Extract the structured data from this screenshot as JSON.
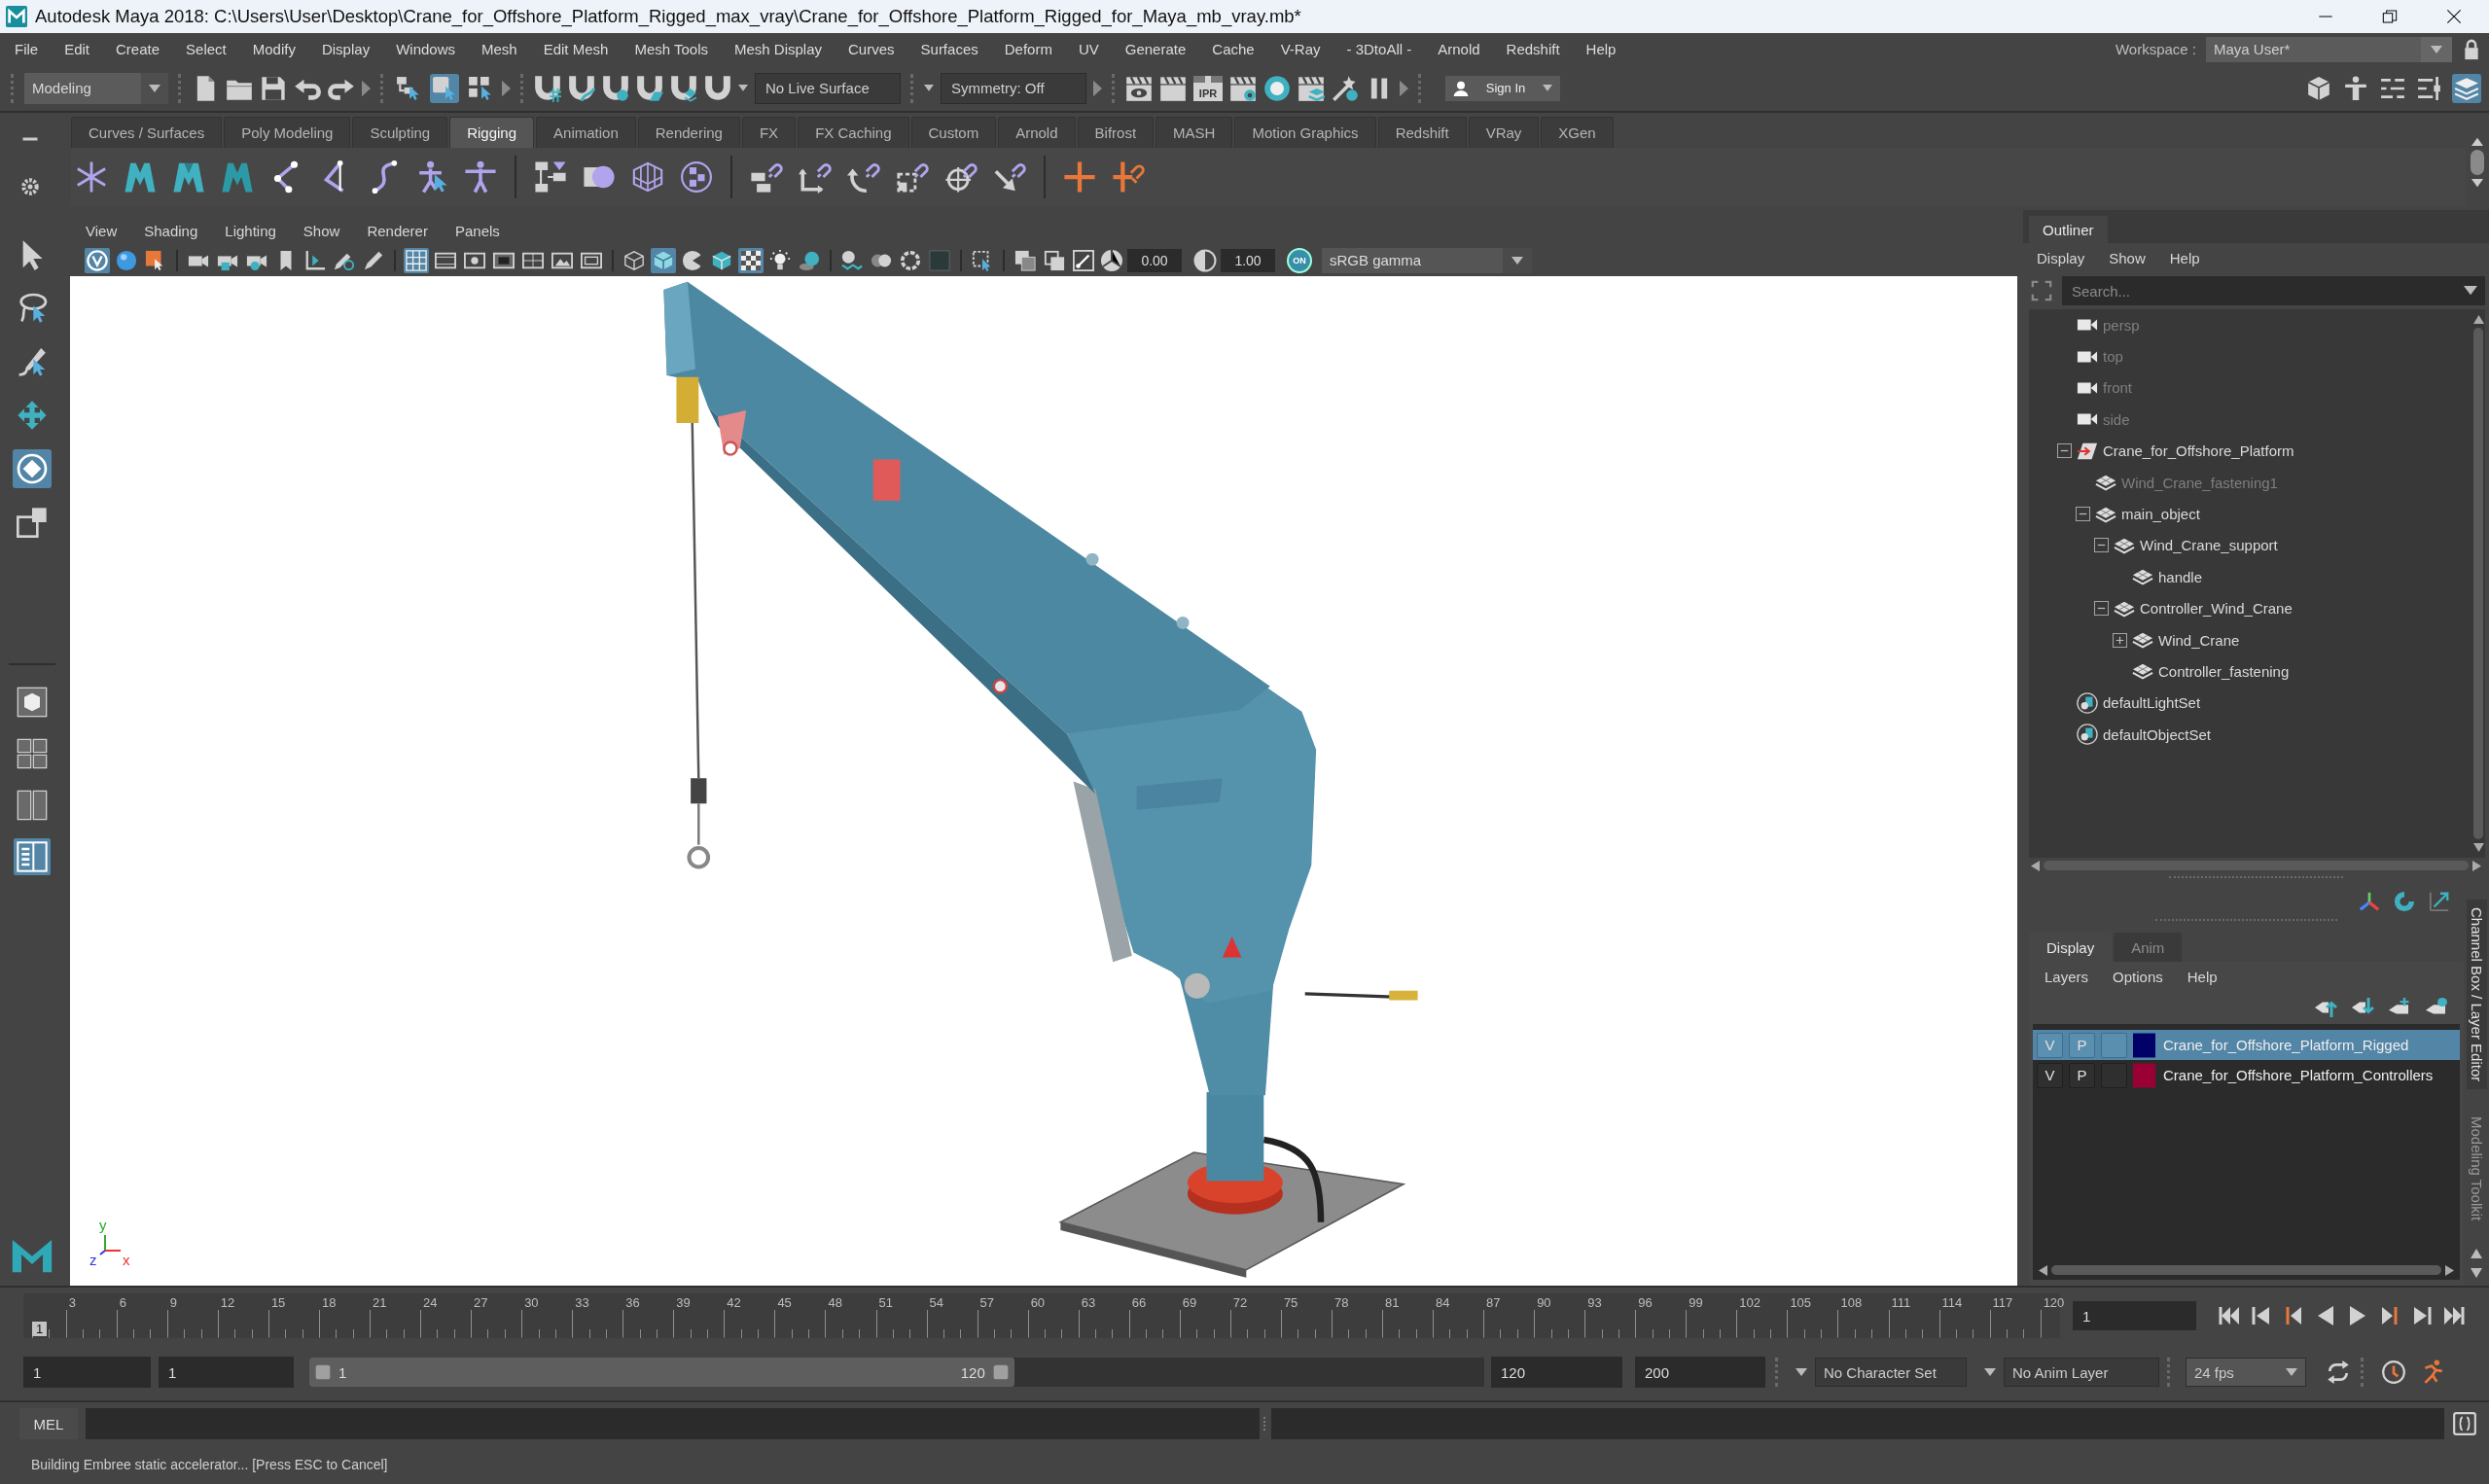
{
  "window": {
    "title": "Autodesk Maya 2018: C:\\Users\\User\\Desktop\\Crane_for_Offshore_Platform_Rigged_max_vray\\Crane_for_Offshore_Platform_Rigged_for_Maya_mb_vray.mb*"
  },
  "menu_bar": {
    "items": [
      "File",
      "Edit",
      "Create",
      "Select",
      "Modify",
      "Display",
      "Windows",
      "Mesh",
      "Edit Mesh",
      "Mesh Tools",
      "Mesh Display",
      "Curves",
      "Surfaces",
      "Deform",
      "UV",
      "Generate",
      "Cache",
      "V-Ray",
      "- 3DtoAll -",
      "Arnold",
      "Redshift",
      "Help"
    ],
    "workspace_label": "Workspace :",
    "workspace": "Maya User*"
  },
  "status_line": {
    "menu_set": "Modeling",
    "selection_modes": [
      {
        "selected": false
      },
      {
        "selected": true
      },
      {
        "selected": false
      }
    ],
    "live_surface": "No Live Surface",
    "symmetry": "Symmetry: Off",
    "ipr_label": "IPR",
    "sign_in": "Sign In",
    "panel_toggles": [
      {
        "on": false
      },
      {
        "on": false
      },
      {
        "on": false
      },
      {
        "on": false
      },
      {
        "on": true
      }
    ]
  },
  "shelf": {
    "tabs": [
      {
        "label": "Curves / Surfaces",
        "selected": false
      },
      {
        "label": "Poly Modeling",
        "selected": false
      },
      {
        "label": "Sculpting",
        "selected": false
      },
      {
        "label": "Rigging",
        "selected": true
      },
      {
        "label": "Animation",
        "selected": false
      },
      {
        "label": "Rendering",
        "selected": false
      },
      {
        "label": "FX",
        "selected": false
      },
      {
        "label": "FX Caching",
        "selected": false
      },
      {
        "label": "Custom",
        "selected": false
      },
      {
        "label": "Arnold",
        "selected": false
      },
      {
        "label": "Bifrost",
        "selected": false
      },
      {
        "label": "MASH",
        "selected": false
      },
      {
        "label": "Motion Graphics",
        "selected": false
      },
      {
        "label": "Redshift",
        "selected": false
      },
      {
        "label": "VRay",
        "selected": false
      },
      {
        "label": "XGen",
        "selected": false
      }
    ]
  },
  "toolbox": {
    "tools": [
      {
        "selected": false
      },
      {
        "selected": false
      },
      {
        "selected": false
      },
      {
        "selected": false
      },
      {
        "selected": true
      },
      {
        "selected": false
      }
    ],
    "layouts": [
      {
        "selected": false
      },
      {
        "selected": false
      },
      {
        "selected": false
      },
      {
        "selected": true
      }
    ]
  },
  "viewport": {
    "menus": [
      "View",
      "Shading",
      "Lighting",
      "Show",
      "Renderer",
      "Panels"
    ],
    "toggles": [
      {
        "on": true
      },
      {
        "on": false
      },
      {
        "on": false
      },
      {
        "on": false
      },
      {
        "on": false
      },
      {
        "on": false
      },
      {
        "on": false
      },
      {
        "on": false
      },
      {
        "on": false
      },
      {
        "on": false
      },
      {
        "on": true
      },
      {
        "on": false
      },
      {
        "on": false
      },
      {
        "on": false
      },
      {
        "on": false
      },
      {
        "on": false
      },
      {
        "on": false
      },
      {
        "on": false
      },
      {
        "on": true
      },
      {
        "on": false
      },
      {
        "on": false
      },
      {
        "on": true
      },
      {
        "on": false
      },
      {
        "on": false
      },
      {
        "on": false
      },
      {
        "on": false
      },
      {
        "on": false
      },
      {
        "on": false
      },
      {
        "on": false
      },
      {
        "on": false
      },
      {
        "on": false
      },
      {
        "on": false
      }
    ],
    "exposure": "0.00",
    "gamma": "1.00",
    "color_management": "ON",
    "view_transform": "sRGB gamma",
    "axis_labels": [
      "y",
      "z",
      "x"
    ]
  },
  "outliner": {
    "title": "Outliner",
    "menus": [
      "Display",
      "Show",
      "Help"
    ],
    "search": {
      "placeholder": "Search..."
    },
    "items": [
      {
        "label": "persp",
        "kind": "camera",
        "dimmed": true
      },
      {
        "label": "top",
        "kind": "camera",
        "dimmed": true
      },
      {
        "label": "front",
        "kind": "camera",
        "dimmed": true
      },
      {
        "label": "side",
        "kind": "camera",
        "dimmed": true
      },
      {
        "label": "Crane_for_Offshore_Platform",
        "kind": "group",
        "dimmed": false,
        "expanded": true,
        "children": [
          {
            "label": "Wind_Crane_fastening1",
            "kind": "mesh",
            "dimmed": true
          },
          {
            "label": "main_object",
            "kind": "mesh",
            "dimmed": false,
            "expanded": true,
            "children": [
              {
                "label": "Wind_Crane_support",
                "kind": "mesh",
                "dimmed": false,
                "expanded": true,
                "children": [
                  {
                    "label": "handle",
                    "kind": "mesh",
                    "dimmed": false
                  }
                ]
              },
              {
                "label": "Controller_Wind_Crane",
                "kind": "mesh",
                "dimmed": false,
                "expanded": true,
                "children": [
                  {
                    "label": "Wind_Crane",
                    "kind": "mesh",
                    "dimmed": false,
                    "expanded": false
                  },
                  {
                    "label": "Controller_fastening",
                    "kind": "mesh",
                    "dimmed": false
                  }
                ]
              }
            ]
          }
        ]
      },
      {
        "label": "defaultLightSet",
        "kind": "set",
        "dimmed": false
      },
      {
        "label": "defaultObjectSet",
        "kind": "set",
        "dimmed": false
      }
    ]
  },
  "layer_editor": {
    "tabs": [
      {
        "label": "Display",
        "selected": true
      },
      {
        "label": "Anim",
        "selected": false
      }
    ],
    "menus": [
      "Layers",
      "Options",
      "Help"
    ],
    "layers": [
      {
        "visibility": "V",
        "playback": "P",
        "name": "Crane_for_Offshore_Platform_Rigged",
        "color": "#000066",
        "selected": true
      },
      {
        "visibility": "V",
        "playback": "P",
        "name": "Crane_for_Offshore_Platform_Controllers",
        "color": "#990033",
        "selected": false
      }
    ]
  },
  "side_tabs": [
    {
      "label": "Channel Box / Layer Editor",
      "selected": true
    },
    {
      "label": "Modeling Toolkit",
      "selected": false
    }
  ],
  "time_slider": {
    "marker": "1",
    "level": 0,
    "ticks": [
      "3",
      "6",
      "9",
      "12",
      "15",
      "18",
      "21",
      "24",
      "27",
      "30",
      "33",
      "36",
      "39",
      "42",
      "45",
      "48",
      "51",
      "54",
      "57",
      "60",
      "63",
      "66",
      "69",
      "72",
      "75",
      "78",
      "81",
      "84",
      "87",
      "90",
      "93",
      "96",
      "99",
      "102",
      "105",
      "108",
      "111",
      "114",
      "117",
      "120"
    ],
    "current_frame": "1"
  },
  "range_slider": {
    "animation_start": "1",
    "playback_start": "1",
    "range_start": "1",
    "range_end": "120",
    "level": 0.6,
    "playback_end": "120",
    "animation_end": "200",
    "character_set": "No Character Set",
    "anim_layer": "No Anim Layer",
    "fps": "24 fps"
  },
  "command_line": {
    "language": "MEL"
  },
  "help_line": {
    "message": "Building Embree static accelerator... [Press ESC to Cancel]"
  }
}
